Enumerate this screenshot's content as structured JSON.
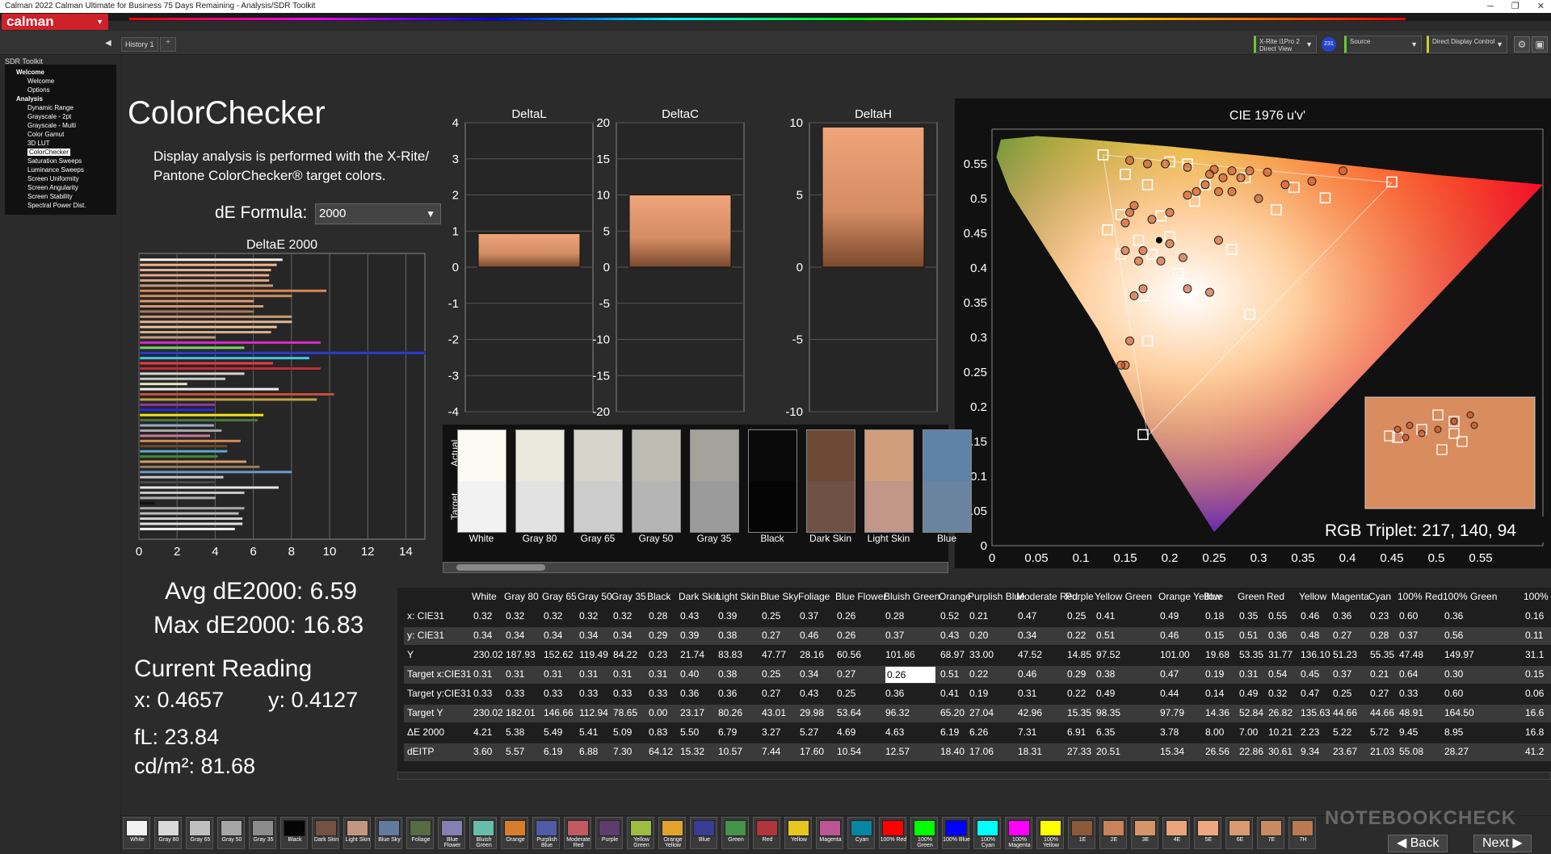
{
  "window": {
    "title": "Calman 2022 Calman Ultimate for Business 75 Days Remaining  - Analysis/SDR Toolkit",
    "minimize": "─",
    "maximize": "❐",
    "close": "✕"
  },
  "app": {
    "logo": "calman",
    "logo_dd": "▼",
    "collapse": "◀"
  },
  "tabs": {
    "history": "History 1",
    "add": "+"
  },
  "devices": {
    "meter_line1": "X-Rite i1Pro 2",
    "meter_line2": "Direct View",
    "meter_badge": "231",
    "source": "Source",
    "display": "Direct Display Control"
  },
  "sidebar": {
    "header": "SDR Toolkit",
    "tree": [
      {
        "label": "Welcome",
        "group": true
      },
      {
        "label": "Welcome"
      },
      {
        "label": "Options"
      },
      {
        "label": "Analysis",
        "group": true
      },
      {
        "label": "Dynamic Range"
      },
      {
        "label": "Grayscale - 2pt"
      },
      {
        "label": "Grayscale - Multi"
      },
      {
        "label": "Color Gamut"
      },
      {
        "label": "3D LUT"
      },
      {
        "label": "ColorChecker",
        "selected": true
      },
      {
        "label": "Saturation Sweeps"
      },
      {
        "label": "Luminance Sweeps"
      },
      {
        "label": "Screen Uniformity"
      },
      {
        "label": "Screen Angularity"
      },
      {
        "label": "Screen Stability"
      },
      {
        "label": "Spectral Power Dist."
      }
    ]
  },
  "page": {
    "title": "ColorChecker",
    "description": "Display analysis is performed with the X-Rite/ Pantone ColorChecker® target colors.",
    "formula_label": "dE Formula:",
    "formula_value": "2000",
    "formula_arrow": "▼"
  },
  "stats": {
    "avg": "Avg dE2000: 6.59",
    "max": "Max dE2000: 16.83",
    "current_reading": "Current Reading",
    "x": "x: 0.4657",
    "y": "y: 0.4127",
    "fl": "fL: 23.84",
    "cdm2": "cd/m²: 81.68"
  },
  "colors": {
    "bar_fill": "#d98c5e",
    "panel_bg": "#111111"
  },
  "chart_data": [
    {
      "type": "bar",
      "title": "DeltaE 2000",
      "orientation": "horizontal",
      "xlim": [
        0,
        15
      ],
      "xticks": [
        "0",
        "2",
        "4",
        "6",
        "8",
        "10",
        "12",
        "14"
      ],
      "values": [
        7.5,
        7.2,
        6.9,
        6.8,
        6.8,
        7.0,
        9.8,
        8.0,
        6.0,
        6.5,
        6.0,
        8.0,
        8.0,
        7.2,
        6.9,
        4.0,
        9.5,
        5.5,
        15.0,
        8.9,
        7.0,
        9.5,
        5.5,
        4.5,
        2.5,
        7.3,
        10.2,
        9.3,
        4.0,
        3.9,
        6.5,
        6.2,
        3.9,
        4.3,
        3.7,
        5.3,
        4.6,
        4.6,
        4.1,
        5.6,
        6.3,
        8.0,
        4.4,
        4.0,
        7.3,
        5.5,
        4.0,
        0.8,
        5.5,
        5.2,
        5.4,
        5.4,
        5.0
      ],
      "colors": [
        "#f6f2ec",
        "#f3b58a",
        "#e7b494",
        "#e7a88a",
        "#d7a686",
        "#cc9a7a",
        "#d88857",
        "#cc8c5e",
        "#e19a6f",
        "#d69a70",
        "#a57a5a",
        "#c99a74",
        "#e2b690",
        "#ecc39a",
        "#d5b08c",
        "#c69a7a",
        "#d52cc9",
        "#7ad36a",
        "#2b3cd2",
        "#41c7f1",
        "#f03a3a",
        "#c82a3c",
        "#d9d6c9",
        "#c8c8c8",
        "#e7e6c0",
        "#ececec",
        "#c94f3a",
        "#c2a34a",
        "#8a3aa8",
        "#2a2ad9",
        "#f2e21a",
        "#4a7a3a",
        "#9da9c9",
        "#a8a8a8",
        "#c87a9a",
        "#d88a5a",
        "#6a4a2a",
        "#5aa9c9",
        "#3a8a3a",
        "#d99a6a",
        "#9a7a5a",
        "#6a9ac9",
        "#c9c9c9",
        "#4a4a4a",
        "#e7e7e7",
        "#c9c9c9",
        "#b0b0b0",
        "#111111",
        "#a9a9a9",
        "#bcbcbc",
        "#cfcfcf",
        "#e2e2e2",
        "#f5f5f5"
      ]
    },
    {
      "type": "bar",
      "title": "DeltaL",
      "ylim": [
        -4,
        4
      ],
      "yticks": [
        "4",
        "3",
        "2",
        "1",
        "0",
        "-1",
        "-2",
        "-3",
        "-4"
      ],
      "values": [
        0.93
      ]
    },
    {
      "type": "bar",
      "title": "DeltaC",
      "ylim": [
        -20,
        20
      ],
      "yticks": [
        "20",
        "15",
        "10",
        "5",
        "0",
        "-5",
        "-10",
        "-15",
        "-20"
      ],
      "values": [
        10
      ]
    },
    {
      "type": "bar",
      "title": "DeltaH",
      "ylim": [
        -10,
        10
      ],
      "yticks": [
        "10",
        "5",
        "0",
        "-5",
        "-10"
      ],
      "values": [
        9.7
      ]
    },
    {
      "type": "scatter",
      "title": "CIE 1976 u'v'",
      "xlim": [
        0,
        0.62
      ],
      "ylim": [
        0,
        0.6
      ],
      "xticks": [
        "0",
        "0.05",
        "0.1",
        "0.15",
        "0.2",
        "0.25",
        "0.3",
        "0.35",
        "0.4",
        "0.45",
        "0.5",
        "0.55"
      ],
      "yticks": [
        "0",
        "0.05",
        "0.1",
        "0.15",
        "0.2",
        "0.25",
        "0.3",
        "0.35",
        "0.4",
        "0.45",
        "0.5",
        "0.55"
      ],
      "targets": [
        [
          0.125,
          0.563
        ],
        [
          0.2,
          0.553
        ],
        [
          0.22,
          0.55
        ],
        [
          0.15,
          0.535
        ],
        [
          0.175,
          0.52
        ],
        [
          0.24,
          0.52
        ],
        [
          0.285,
          0.53
        ],
        [
          0.34,
          0.516
        ],
        [
          0.45,
          0.524
        ],
        [
          0.375,
          0.501
        ],
        [
          0.32,
          0.484
        ],
        [
          0.228,
          0.496
        ],
        [
          0.19,
          0.475
        ],
        [
          0.145,
          0.477
        ],
        [
          0.13,
          0.455
        ],
        [
          0.145,
          0.42
        ],
        [
          0.18,
          0.42
        ],
        [
          0.2,
          0.445
        ],
        [
          0.165,
          0.44
        ],
        [
          0.21,
          0.392
        ],
        [
          0.27,
          0.427
        ],
        [
          0.17,
          0.36
        ],
        [
          0.29,
          0.333
        ],
        [
          0.175,
          0.295
        ],
        [
          0.17,
          0.16
        ]
      ],
      "measured": [
        [
          0.155,
          0.555
        ],
        [
          0.175,
          0.55
        ],
        [
          0.195,
          0.55
        ],
        [
          0.22,
          0.545
        ],
        [
          0.25,
          0.542
        ],
        [
          0.27,
          0.54
        ],
        [
          0.29,
          0.54
        ],
        [
          0.31,
          0.538
        ],
        [
          0.245,
          0.535
        ],
        [
          0.26,
          0.53
        ],
        [
          0.28,
          0.53
        ],
        [
          0.24,
          0.52
        ],
        [
          0.23,
          0.51
        ],
        [
          0.255,
          0.51
        ],
        [
          0.27,
          0.51
        ],
        [
          0.22,
          0.505
        ],
        [
          0.3,
          0.5
        ],
        [
          0.36,
          0.525
        ],
        [
          0.395,
          0.54
        ],
        [
          0.33,
          0.52
        ],
        [
          0.2,
          0.48
        ],
        [
          0.18,
          0.47
        ],
        [
          0.155,
          0.48
        ],
        [
          0.16,
          0.49
        ],
        [
          0.15,
          0.465
        ],
        [
          0.2,
          0.435
        ],
        [
          0.17,
          0.425
        ],
        [
          0.19,
          0.41
        ],
        [
          0.15,
          0.425
        ],
        [
          0.165,
          0.41
        ],
        [
          0.255,
          0.44
        ],
        [
          0.215,
          0.415
        ],
        [
          0.22,
          0.37
        ],
        [
          0.245,
          0.365
        ],
        [
          0.17,
          0.37
        ],
        [
          0.16,
          0.36
        ],
        [
          0.155,
          0.295
        ],
        [
          0.15,
          0.26
        ],
        [
          0.145,
          0.26
        ]
      ],
      "measured_dark": [
        0.188,
        0.44
      ],
      "current_swatch": "#d98c5e",
      "readout": "RGB Triplet: 217, 140, 94"
    }
  ],
  "swatches": {
    "actual_label": "Actual",
    "target_label": "Target",
    "items": [
      {
        "name": "White",
        "actual": "#fbfbf3",
        "target": "#f2f2f2"
      },
      {
        "name": "Gray 80",
        "actual": "#e9e9de",
        "target": "#e2e2e2"
      },
      {
        "name": "Gray 65",
        "actual": "#d5d5cb",
        "target": "#cccccc"
      },
      {
        "name": "Gray 50",
        "actual": "#bdbdb4",
        "target": "#b5b5b5"
      },
      {
        "name": "Gray 35",
        "actual": "#a3a39b",
        "target": "#9b9b9b"
      },
      {
        "name": "Black",
        "actual": "#0a0a0a",
        "target": "#050505"
      },
      {
        "name": "Dark Skin",
        "actual": "#6e4a34",
        "target": "#6f5244"
      },
      {
        "name": "Light Skin",
        "actual": "#d09e7a",
        "target": "#c3968a"
      },
      {
        "name": "Blue",
        "actual": "#5f82a8",
        "target": "#6a84a0"
      }
    ]
  },
  "table": {
    "columns": [
      "White",
      "Gray 80",
      "Gray 65",
      "Gray 50",
      "Gray 35",
      "Black",
      "Dark Skin",
      "Light Skin",
      "Blue Sky",
      "Foliage",
      "Blue Flower",
      "Bluish Green",
      "Orange",
      "Purplish Blue",
      "Moderate Red",
      "Purple",
      "Yellow Green",
      "Orange Yellow",
      "Blue",
      "Green",
      "Red",
      "Yellow",
      "Magenta",
      "Cyan",
      "100% Red",
      "100% Green",
      "100%"
    ],
    "rows": [
      {
        "label": "x: CIE31",
        "cells": [
          "0.32",
          "0.32",
          "0.32",
          "0.32",
          "0.32",
          "0.28",
          "0.43",
          "0.39",
          "0.25",
          "0.37",
          "0.26",
          "0.28",
          "0.52",
          "0.21",
          "0.47",
          "0.25",
          "0.41",
          "0.49",
          "0.18",
          "0.35",
          "0.55",
          "0.46",
          "0.36",
          "0.23",
          "0.60",
          "0.36",
          "0.16"
        ]
      },
      {
        "label": "y: CIE31",
        "cells": [
          "0.34",
          "0.34",
          "0.34",
          "0.34",
          "0.34",
          "0.29",
          "0.39",
          "0.38",
          "0.27",
          "0.46",
          "0.26",
          "0.37",
          "0.43",
          "0.20",
          "0.34",
          "0.22",
          "0.51",
          "0.46",
          "0.15",
          "0.51",
          "0.36",
          "0.48",
          "0.27",
          "0.28",
          "0.37",
          "0.56",
          "0.11"
        ]
      },
      {
        "label": "Y",
        "cells": [
          "230.02",
          "187.93",
          "152.62",
          "119.49",
          "84.22",
          "0.23",
          "21.74",
          "83.83",
          "47.77",
          "28.16",
          "60.56",
          "101.86",
          "68.97",
          "33.00",
          "47.52",
          "14.85",
          "97.52",
          "101.00",
          "19.68",
          "53.35",
          "31.77",
          "136.10",
          "51.23",
          "55.35",
          "47.48",
          "149.97",
          "31.1"
        ]
      },
      {
        "label": "Target x:CIE31",
        "cells": [
          "0.31",
          "0.31",
          "0.31",
          "0.31",
          "0.31",
          "0.31",
          "0.40",
          "0.38",
          "0.25",
          "0.34",
          "0.27",
          "0.26",
          "0.51",
          "0.22",
          "0.46",
          "0.29",
          "0.38",
          "0.47",
          "0.19",
          "0.31",
          "0.54",
          "0.45",
          "0.37",
          "0.21",
          "0.64",
          "0.30",
          "0.15"
        ]
      },
      {
        "label": "Target y:CIE31",
        "cells": [
          "0.33",
          "0.33",
          "0.33",
          "0.33",
          "0.33",
          "0.33",
          "0.36",
          "0.36",
          "0.27",
          "0.43",
          "0.25",
          "0.36",
          "0.41",
          "0.19",
          "0.31",
          "0.22",
          "0.49",
          "0.44",
          "0.14",
          "0.49",
          "0.32",
          "0.47",
          "0.25",
          "0.27",
          "0.33",
          "0.60",
          "0.06"
        ]
      },
      {
        "label": "Target Y",
        "cells": [
          "230.02",
          "182.01",
          "146.66",
          "112.94",
          "78.65",
          "0.00",
          "23.17",
          "80.26",
          "43.01",
          "29.98",
          "53.64",
          "96.32",
          "65.20",
          "27.04",
          "42.96",
          "15.35",
          "98.35",
          "97.79",
          "14.36",
          "52.84",
          "26.82",
          "135.63",
          "44.66",
          "44.66",
          "48.91",
          "164.50",
          "16.6"
        ]
      },
      {
        "label": "ΔE 2000",
        "cells": [
          "4.21",
          "5.38",
          "5.49",
          "5.41",
          "5.09",
          "0.83",
          "5.50",
          "6.79",
          "3.27",
          "5.27",
          "4.69",
          "4.63",
          "6.19",
          "6.26",
          "7.31",
          "6.91",
          "6.35",
          "3.78",
          "8.00",
          "7.00",
          "10.21",
          "2.23",
          "5.22",
          "5.72",
          "9.45",
          "8.95",
          "16.8"
        ]
      },
      {
        "label": "dEITP",
        "cells": [
          "3.60",
          "5.57",
          "6.19",
          "6.88",
          "7.30",
          "64.12",
          "15.32",
          "10.57",
          "7.44",
          "17.60",
          "10.54",
          "12.57",
          "18.40",
          "17.06",
          "18.31",
          "27.33",
          "20.51",
          "15.34",
          "26.56",
          "22.86",
          "30.61",
          "9.34",
          "23.67",
          "21.03",
          "55.08",
          "28.27",
          "41.2"
        ]
      }
    ]
  },
  "bottom": {
    "swatches": [
      {
        "label": "White",
        "color": "#f2f2f2"
      },
      {
        "label": "Gray 80",
        "color": "#d9d9d9"
      },
      {
        "label": "Gray 65",
        "color": "#bfbfbf"
      },
      {
        "label": "Gray 50",
        "color": "#a6a6a6"
      },
      {
        "label": "Gray 35",
        "color": "#8c8c8c"
      },
      {
        "label": "Black",
        "color": "#050505"
      },
      {
        "label": "Dark Skin",
        "color": "#735244"
      },
      {
        "label": "Light Skin",
        "color": "#c29682"
      },
      {
        "label": "Blue Sky",
        "color": "#627a9d"
      },
      {
        "label": "Foliage",
        "color": "#576c43"
      },
      {
        "label": "Blue Flower",
        "color": "#8580b1"
      },
      {
        "label": "Bluish Green",
        "color": "#67bdaa"
      },
      {
        "label": "Orange",
        "color": "#d67e2c"
      },
      {
        "label": "Purplish Blue",
        "color": "#505ba6"
      },
      {
        "label": "Moderate Red",
        "color": "#c15a63"
      },
      {
        "label": "Purple",
        "color": "#5e3c6c"
      },
      {
        "label": "Yellow Green",
        "color": "#9dbc40"
      },
      {
        "label": "Orange Yellow",
        "color": "#e0a32e"
      },
      {
        "label": "Blue",
        "color": "#383d96"
      },
      {
        "label": "Green",
        "color": "#469449"
      },
      {
        "label": "Red",
        "color": "#af363c"
      },
      {
        "label": "Yellow",
        "color": "#e7c71f"
      },
      {
        "label": "Magenta",
        "color": "#bb5695"
      },
      {
        "label": "Cyan",
        "color": "#0885a1"
      },
      {
        "label": "100% Red",
        "color": "#ff0000"
      },
      {
        "label": "100% Green",
        "color": "#00ff00"
      },
      {
        "label": "100% Blue",
        "color": "#0000ff"
      },
      {
        "label": "100% Cyan",
        "color": "#00ffff"
      },
      {
        "label": "100% Magenta",
        "color": "#ff00ff"
      },
      {
        "label": "100% Yellow",
        "color": "#ffff00"
      },
      {
        "label": "1E",
        "color": "#8a5a3a"
      },
      {
        "label": "2E",
        "color": "#c9835a"
      },
      {
        "label": "3E",
        "color": "#d6946a"
      },
      {
        "label": "4E",
        "color": "#e8a47a"
      },
      {
        "label": "5E",
        "color": "#eda882"
      },
      {
        "label": "6E",
        "color": "#d99a72"
      },
      {
        "label": "7E",
        "color": "#c98a62"
      },
      {
        "label": "7H",
        "color": "#b97a52"
      }
    ],
    "back": "Back",
    "next": "Next",
    "watermark": "NOTEBOOKCHECK"
  }
}
